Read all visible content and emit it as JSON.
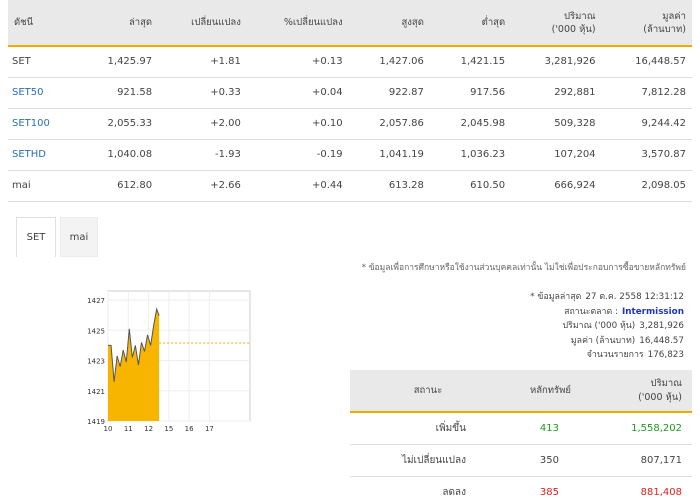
{
  "index_table": {
    "headers": [
      "ดัชนี",
      "ล่าสุด",
      "เปลี่ยนแปลง",
      "%เปลี่ยนแปลง",
      "สูงสุด",
      "ต่ำสุด",
      "ปริมาณ\n('000 หุ้น)",
      "มูลค่า\n(ล้านบาท)"
    ],
    "rows": [
      {
        "name": "SET",
        "last": "1,425.97",
        "chg": "+1.81",
        "pct": "+0.13",
        "high": "1,427.06",
        "low": "1,421.15",
        "vol": "3,281,926",
        "val": "16,448.57"
      },
      {
        "name": "SET50",
        "last": "921.58",
        "chg": "+0.33",
        "pct": "+0.04",
        "high": "922.87",
        "low": "917.56",
        "vol": "292,881",
        "val": "7,812.28"
      },
      {
        "name": "SET100",
        "last": "2,055.33",
        "chg": "+2.00",
        "pct": "+0.10",
        "high": "2,057.86",
        "low": "2,045.98",
        "vol": "509,328",
        "val": "9,244.42"
      },
      {
        "name": "SETHD",
        "last": "1,040.08",
        "chg": "-1.93",
        "pct": "-0.19",
        "high": "1,041.19",
        "low": "1,036.23",
        "vol": "107,204",
        "val": "3,570.87"
      },
      {
        "name": "mai",
        "last": "612.80",
        "chg": "+2.66",
        "pct": "+0.44",
        "high": "613.28",
        "low": "610.50",
        "vol": "666,924",
        "val": "2,098.05"
      }
    ]
  },
  "tabs": [
    {
      "label": "SET"
    },
    {
      "label": "mai"
    }
  ],
  "disclaimer": "* ข้อมูลเพื่อการศึกษาหรือใช้งานส่วนบุคคลเท่านั้น ไม่ใช่เพื่อประกอบการซื้อขายหลักทรัพย์",
  "info": {
    "updated_label": "* ข้อมูลล่าสุด",
    "updated_value": "27 ต.ค. 2558 12:31:12",
    "market_status_label": "สถานะตลาด :",
    "market_status_value": "Intermission",
    "volume_label": "ปริมาณ ('000 หุ้น)",
    "volume_value": "3,281,926",
    "value_label": "มูลค่า (ล้านบาท)",
    "value_value": "16,448.57",
    "deals_label": "จำนวนรายการ",
    "deals_value": "176,823"
  },
  "stat_table": {
    "headers": [
      "สถานะ",
      "หลักทรัพย์",
      "ปริมาณ\n('000 หุ้น)"
    ],
    "rows": [
      {
        "status": "เพิ่มขึ้น",
        "count": "413",
        "volume": "1,558,202",
        "color": "#1f9a1f"
      },
      {
        "status": "ไม่เปลี่ยนแปลง",
        "count": "350",
        "volume": "807,171",
        "color": "#444444"
      },
      {
        "status": "ลดลง",
        "count": "385",
        "volume": "881,408",
        "color": "#e0211d"
      }
    ]
  },
  "chart_data": {
    "type": "area",
    "y_ticks": [
      "1427",
      "1425",
      "1423",
      "1421",
      "1419"
    ],
    "x_ticks": [
      "10",
      "11",
      "12",
      "15",
      "16",
      "17"
    ],
    "ylim": [
      1419,
      1427.6
    ],
    "xlim": [
      10,
      17
    ],
    "reference_line": 1424.16,
    "fill_color": "#f7b500",
    "line_color": "#555555",
    "x": [
      10.0,
      10.15,
      10.3,
      10.45,
      10.6,
      10.75,
      10.9,
      11.05,
      11.2,
      11.35,
      11.5,
      11.65,
      11.8,
      11.95,
      12.1,
      12.25,
      12.4,
      12.52
    ],
    "values": [
      1424.0,
      1424.0,
      1421.6,
      1423.3,
      1422.6,
      1423.7,
      1422.9,
      1425.1,
      1423.2,
      1424.0,
      1422.7,
      1424.2,
      1423.6,
      1424.7,
      1424.0,
      1425.3,
      1426.4,
      1425.97
    ]
  }
}
